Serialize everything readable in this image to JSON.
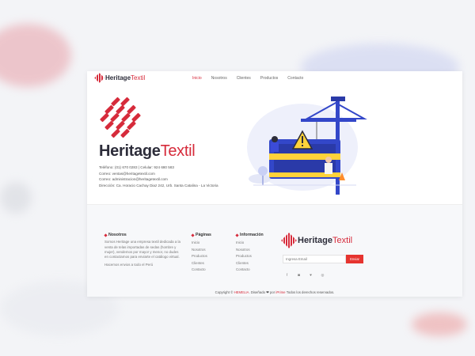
{
  "nav": {
    "brand_a": "Heritage",
    "brand_b": "Textil",
    "items": [
      "Inicio",
      "Nosotros",
      "Clientes",
      "Productos",
      "Contacto"
    ]
  },
  "hero": {
    "brand_a": "Heritage",
    "brand_b": "Textil",
    "contact_lines": [
      "Teléfono: (01) 670 0283 | Celular: 924 680 583",
      "Correo: ventas@heritagetextil.com",
      "Correo: administracion@heritagetextil.com",
      "Dirección: Ca. Horacio Cachay Diaz 242, Urb. Santa Catalina - La Victoria"
    ]
  },
  "footer": {
    "about_title": "Nosotros",
    "about_text": "Somos Heritage una empresa textil dedicada a la venta de telas importadas de sedas (hombre y mujer), vendemos por mayor y menor, no dudes en contactarnos para enviarte el catálogo virtual.",
    "about_sub": "Hacemos envios a todo el Perú",
    "pages_title": "Páginas",
    "pages": [
      "Inicio",
      "Nosotros",
      "Productos",
      "Clientes",
      "Contacto"
    ],
    "info_title": "Información",
    "info": [
      "Inicio",
      "Nosotros",
      "Productos",
      "Clientes",
      "Contacto"
    ],
    "brand_a": "Heritage",
    "brand_b": "Textil",
    "email_placeholder": "Ingresa Email",
    "send_label": "Enviar",
    "social_icons": [
      "facebook-icon",
      "instagram-icon",
      "twitter-icon",
      "whatsapp-icon"
    ],
    "social_glyphs": [
      "f",
      "◙",
      "♥",
      "◎"
    ],
    "copyright_prefix": "Copyright ©",
    "copyright_brand": "HEMELIA",
    "copyright_mid": ". Diseñado ❤ por",
    "copyright_author": "iPrime",
    "copyright_suffix": "Todos los derechos reservados."
  },
  "colors": {
    "accent": "#d62b3b",
    "dark": "#2d2d3a",
    "illustration_blue": "#3347c9"
  }
}
